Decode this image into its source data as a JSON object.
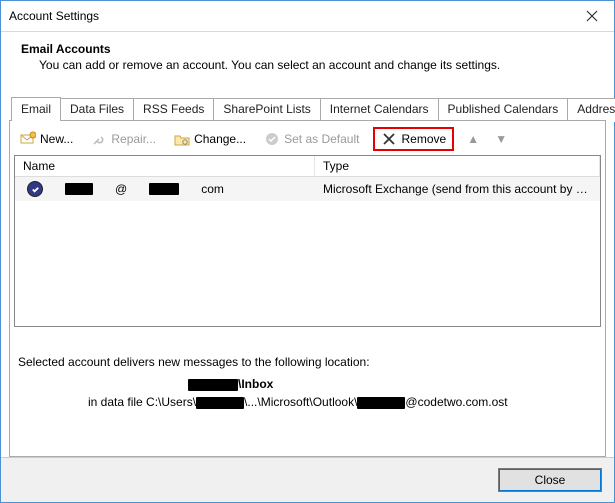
{
  "window": {
    "title": "Account Settings"
  },
  "header": {
    "title": "Email Accounts",
    "description": "You can add or remove an account. You can select an account and change its settings."
  },
  "tabs": [
    {
      "label": "Email"
    },
    {
      "label": "Data Files"
    },
    {
      "label": "RSS Feeds"
    },
    {
      "label": "SharePoint Lists"
    },
    {
      "label": "Internet Calendars"
    },
    {
      "label": "Published Calendars"
    },
    {
      "label": "Address Books"
    }
  ],
  "toolbar": {
    "new_label": "New...",
    "repair_label": "Repair...",
    "change_label": "Change...",
    "set_default_label": "Set as Default",
    "remove_label": "Remove"
  },
  "list": {
    "columns": {
      "name": "Name",
      "type": "Type"
    },
    "rows": [
      {
        "name_at": "@",
        "name_domain": "com",
        "type": "Microsoft Exchange (send from this account by def...",
        "is_default": true
      }
    ]
  },
  "info": {
    "line1": "Selected account delivers new messages to the following location:",
    "folder": "\\Inbox",
    "path_prefix": "in data file C:\\Users\\",
    "path_mid": "\\...\\Microsoft\\Outlook\\",
    "path_suffix": "@codetwo.com.ost"
  },
  "footer": {
    "close_label": "Close"
  }
}
